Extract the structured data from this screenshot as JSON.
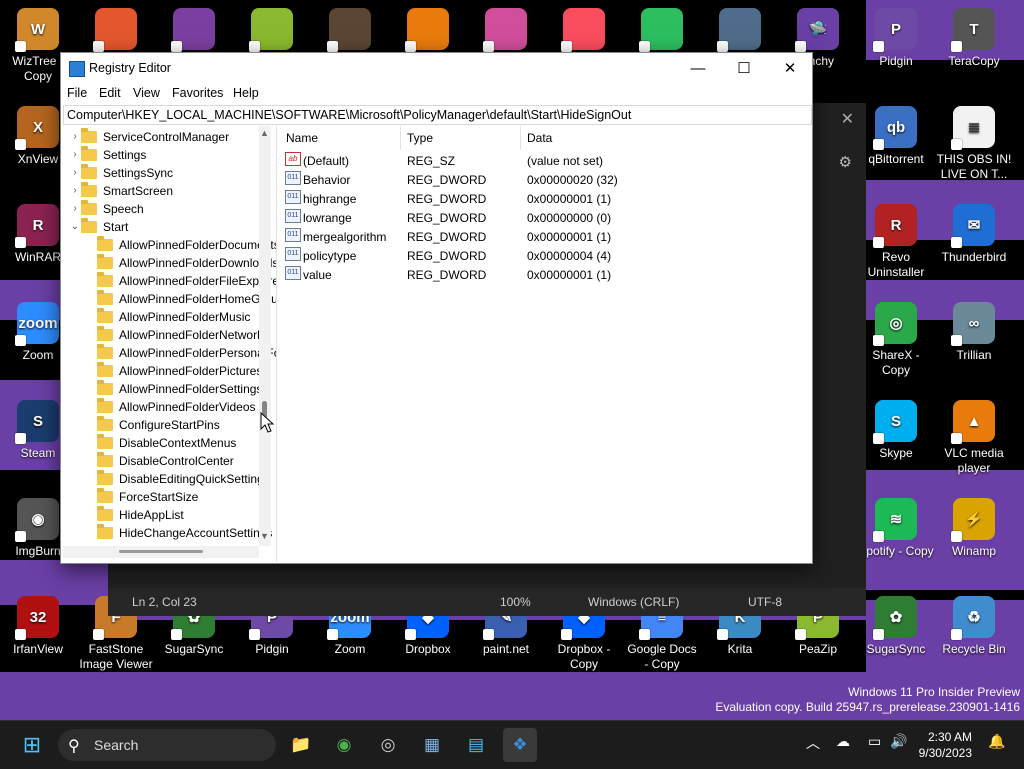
{
  "desktop": {
    "icons": [
      {
        "label": "WizTree - Copy",
        "color": "#d0882b",
        "glyph": "W"
      },
      {
        "label": "XnView",
        "color": "#b5651d",
        "glyph": "X"
      },
      {
        "label": "WinRAR",
        "color": "#8b2252",
        "glyph": "R"
      },
      {
        "label": "Zoom",
        "color": "#2d8cff",
        "glyph": "zoom"
      },
      {
        "label": "Steam",
        "color": "#1b3c6e",
        "glyph": "S"
      },
      {
        "label": "ImgBurn",
        "color": "#555555",
        "glyph": "◉"
      },
      {
        "label": "IrfanView",
        "color": "#b01010",
        "glyph": "32"
      },
      {
        "label": "FastStone Image Viewer",
        "color": "#c87a2a",
        "glyph": "F"
      },
      {
        "label": "SugarSync",
        "color": "#2f7d32",
        "glyph": "✿"
      },
      {
        "label": "Pidgin",
        "color": "#6d4aa5",
        "glyph": "P"
      },
      {
        "label": "Zoom",
        "color": "#2d8cff",
        "glyph": "zoom"
      },
      {
        "label": "Dropbox",
        "color": "#0061fe",
        "glyph": "◆"
      },
      {
        "label": "paint.net",
        "color": "#3a5fb0",
        "glyph": "✎"
      },
      {
        "label": "Dropbox - Copy",
        "color": "#0061fe",
        "glyph": "◆"
      },
      {
        "label": "Google Docs - Copy",
        "color": "#4285f4",
        "glyph": "≡"
      },
      {
        "label": "Krita",
        "color": "#3b8ac4",
        "glyph": "K"
      },
      {
        "label": "PeaZip",
        "color": "#8ab82e",
        "glyph": "P"
      },
      {
        "label": "SugarSync",
        "color": "#2f7d32",
        "glyph": "✿"
      },
      {
        "label": "Recycle Bin",
        "color": "#3f8ccf",
        "glyph": "♻"
      },
      {
        "label": "Pidgin",
        "color": "#6d4aa5",
        "glyph": "P"
      },
      {
        "label": "TeraCopy",
        "color": "#555555",
        "glyph": "T"
      },
      {
        "label": "qBittorrent",
        "color": "#3a6fc4",
        "glyph": "qb"
      },
      {
        "label": "THIS OBS IN! LIVE ON T...",
        "color": "#f2f2f2",
        "glyph": "≣"
      },
      {
        "label": "Revo Uninstaller",
        "color": "#b22222",
        "glyph": "R"
      },
      {
        "label": "Thunderbird",
        "color": "#1f6ed4",
        "glyph": "✉"
      },
      {
        "label": "ShareX - Copy",
        "color": "#2ba84a",
        "glyph": "◎"
      },
      {
        "label": "Trillian",
        "color": "#6a8a9a",
        "glyph": "∞"
      },
      {
        "label": "Skype",
        "color": "#00aff0",
        "glyph": "S"
      },
      {
        "label": "VLC media player",
        "color": "#e87b0c",
        "glyph": "▲"
      },
      {
        "label": "Spotify - Copy",
        "color": "#1db954",
        "glyph": "≋"
      },
      {
        "label": "Winamp",
        "color": "#d9a400",
        "glyph": "⚡"
      },
      {
        "label": "unchy",
        "color": "#6a3fa6",
        "glyph": "🛸"
      }
    ]
  },
  "notepad": {
    "status_position": "Ln 2, Col 23",
    "status_zoom": "100%",
    "status_eol": "Windows (CRLF)",
    "status_encoding": "UTF-8",
    "close_glyph": "✕",
    "gear_glyph": "⚙"
  },
  "regedit": {
    "title": "Registry Editor",
    "menu": [
      "File",
      "Edit",
      "View",
      "Favorites",
      "Help"
    ],
    "address": "Computer\\HKEY_LOCAL_MACHINE\\SOFTWARE\\Microsoft\\PolicyManager\\default\\Start\\HideSignOut",
    "window_buttons": {
      "minimize": "—",
      "maximize": "☐",
      "close": "✕"
    },
    "tree": [
      {
        "label": "ServiceControlManager",
        "level": 0,
        "expander": "›"
      },
      {
        "label": "Settings",
        "level": 0,
        "expander": "›"
      },
      {
        "label": "SettingsSync",
        "level": 0,
        "expander": "›"
      },
      {
        "label": "SmartScreen",
        "level": 0,
        "expander": "›"
      },
      {
        "label": "Speech",
        "level": 0,
        "expander": "›"
      },
      {
        "label": "Start",
        "level": 0,
        "expander": "⌄"
      },
      {
        "label": "AllowPinnedFolderDocuments",
        "level": 1,
        "expander": ""
      },
      {
        "label": "AllowPinnedFolderDownloads",
        "level": 1,
        "expander": ""
      },
      {
        "label": "AllowPinnedFolderFileExplorer",
        "level": 1,
        "expander": ""
      },
      {
        "label": "AllowPinnedFolderHomeGroup",
        "level": 1,
        "expander": ""
      },
      {
        "label": "AllowPinnedFolderMusic",
        "level": 1,
        "expander": ""
      },
      {
        "label": "AllowPinnedFolderNetwork",
        "level": 1,
        "expander": ""
      },
      {
        "label": "AllowPinnedFolderPersonalFolder",
        "level": 1,
        "expander": ""
      },
      {
        "label": "AllowPinnedFolderPictures",
        "level": 1,
        "expander": ""
      },
      {
        "label": "AllowPinnedFolderSettings",
        "level": 1,
        "expander": ""
      },
      {
        "label": "AllowPinnedFolderVideos",
        "level": 1,
        "expander": ""
      },
      {
        "label": "ConfigureStartPins",
        "level": 1,
        "expander": ""
      },
      {
        "label": "DisableContextMenus",
        "level": 1,
        "expander": ""
      },
      {
        "label": "DisableControlCenter",
        "level": 1,
        "expander": ""
      },
      {
        "label": "DisableEditingQuickSettings",
        "level": 1,
        "expander": ""
      },
      {
        "label": "ForceStartSize",
        "level": 1,
        "expander": ""
      },
      {
        "label": "HideAppList",
        "level": 1,
        "expander": ""
      },
      {
        "label": "HideChangeAccountSettings",
        "level": 1,
        "expander": ""
      }
    ],
    "columns": [
      "Name",
      "Type",
      "Data"
    ],
    "values": [
      {
        "name": "(Default)",
        "type": "REG_SZ",
        "data": "(value not set)",
        "icon": "ab"
      },
      {
        "name": "Behavior",
        "type": "REG_DWORD",
        "data": "0x00000020 (32)",
        "icon": "011"
      },
      {
        "name": "highrange",
        "type": "REG_DWORD",
        "data": "0x00000001 (1)",
        "icon": "011"
      },
      {
        "name": "lowrange",
        "type": "REG_DWORD",
        "data": "0x00000000 (0)",
        "icon": "011"
      },
      {
        "name": "mergealgorithm",
        "type": "REG_DWORD",
        "data": "0x00000001 (1)",
        "icon": "011"
      },
      {
        "name": "policytype",
        "type": "REG_DWORD",
        "data": "0x00000004 (4)",
        "icon": "011"
      },
      {
        "name": "value",
        "type": "REG_DWORD",
        "data": "0x00000001 (1)",
        "icon": "011"
      }
    ]
  },
  "watermark": {
    "line1": "Windows 11 Pro Insider Preview",
    "line2": "Evaluation copy. Build 25947.rs_prerelease.230901-1416"
  },
  "taskbar": {
    "search_placeholder": "Search",
    "search_glyph": "⚲",
    "start_glyph": "⊞",
    "apps": [
      {
        "name": "file-explorer",
        "glyph": "📁",
        "color": "#f2c744"
      },
      {
        "name": "chrome",
        "glyph": "◉",
        "color": "#4caf50"
      },
      {
        "name": "obs",
        "glyph": "◎",
        "color": "#cccccc"
      },
      {
        "name": "photos",
        "glyph": "▦",
        "color": "#7fb3e8"
      },
      {
        "name": "notepad",
        "glyph": "▤",
        "color": "#4fc3f7"
      },
      {
        "name": "regedit",
        "glyph": "❖",
        "color": "#3d8fe0"
      }
    ],
    "tray": {
      "chevron": "︿",
      "network": "☁",
      "display": "▭",
      "volume": "🔊",
      "bell": "🔔"
    },
    "time": "2:30 AM",
    "date": "9/30/2023"
  }
}
